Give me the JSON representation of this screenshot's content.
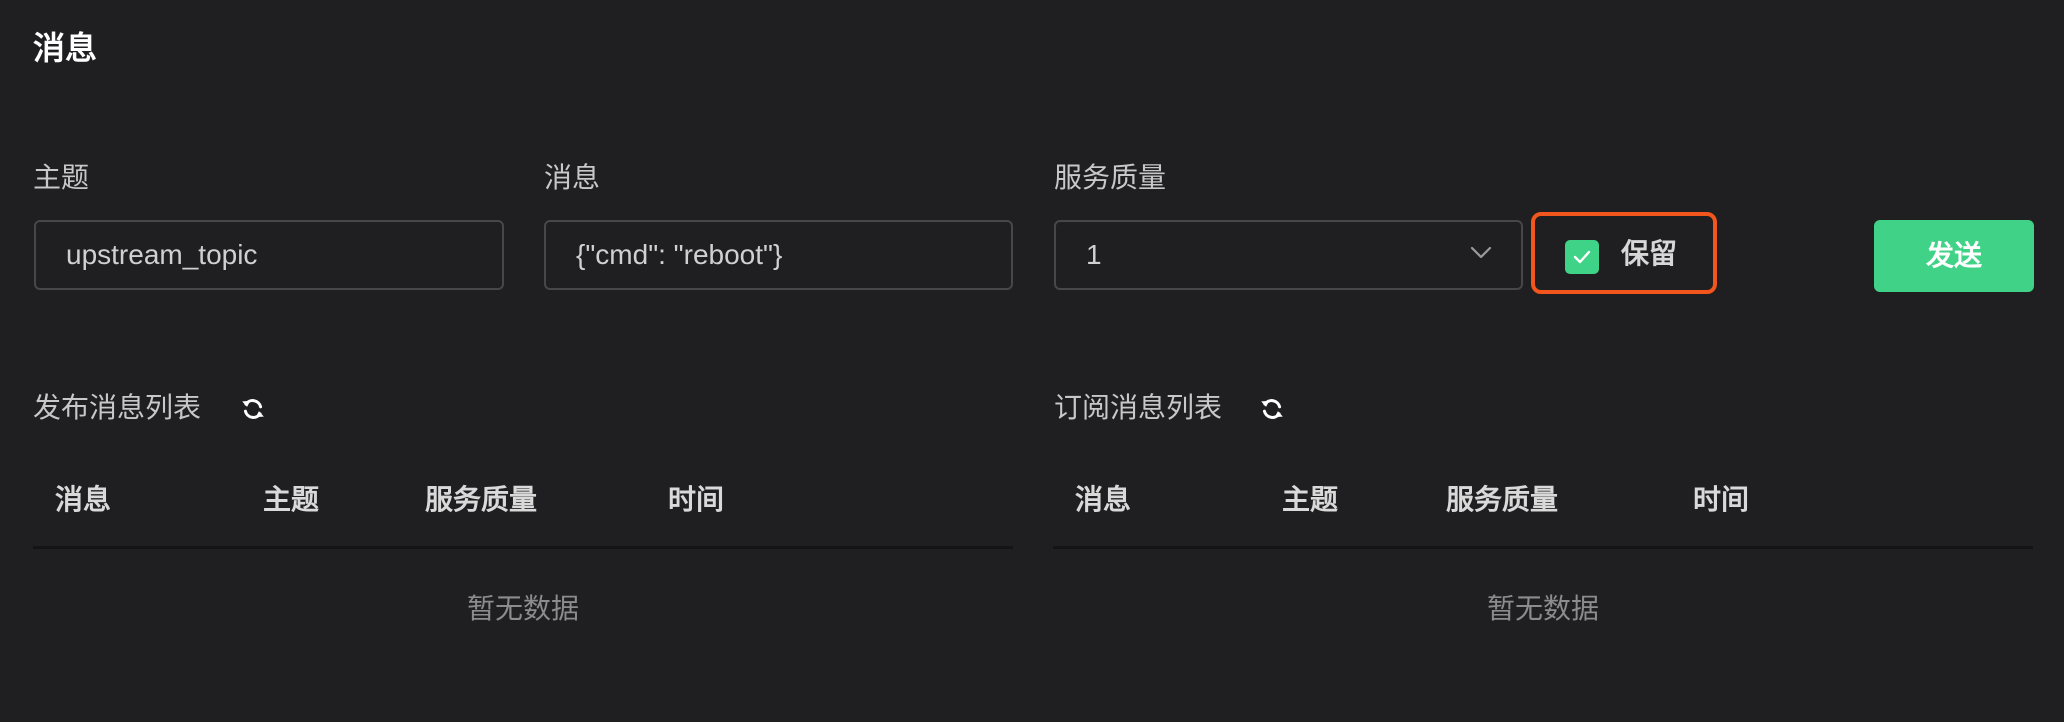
{
  "header": {
    "title": "消息"
  },
  "form": {
    "topic_label": "主题",
    "topic_value": "upstream_topic",
    "message_label": "消息",
    "message_value": "{\"cmd\": \"reboot\"}",
    "qos_label": "服务质量",
    "qos_value": "1",
    "retain_label": "保留",
    "retain_checked": true,
    "send_label": "发送"
  },
  "published": {
    "title": "发布消息列表",
    "columns": [
      "消息",
      "主题",
      "服务质量",
      "时间"
    ],
    "rows": [],
    "empty_text": "暂无数据"
  },
  "subscribed": {
    "title": "订阅消息列表",
    "columns": [
      "消息",
      "主题",
      "服务质量",
      "时间"
    ],
    "rows": [],
    "empty_text": "暂无数据"
  },
  "colors": {
    "background": "#1f1e20",
    "accent_green": "#40d387",
    "highlight_orange": "#f2561d"
  },
  "icons": {
    "refresh": "refresh-icon",
    "chevron": "chevron-down-icon",
    "check": "check-icon"
  }
}
